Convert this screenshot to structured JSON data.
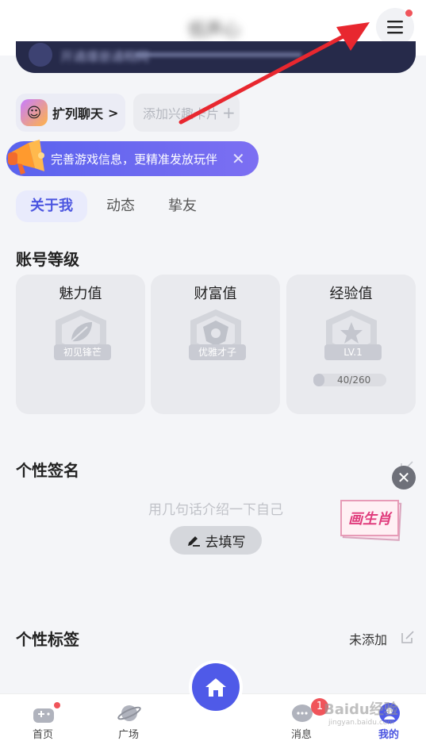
{
  "header": {
    "nickname": "低声心",
    "banner_text": "开通爆册通畅网"
  },
  "chips": {
    "chat_label": "扩列聊天",
    "chat_chevron": ">",
    "add_label": "添加兴趣卡片",
    "add_plus": "+"
  },
  "promo": {
    "text": "完善游戏信息，更精准发放玩伴",
    "close": "✕"
  },
  "tabs": [
    {
      "label": "关于我",
      "active": true
    },
    {
      "label": "动态",
      "active": false
    },
    {
      "label": "挚友",
      "active": false
    }
  ],
  "level_section": {
    "title": "账号等级",
    "cards": [
      {
        "title": "魅力值",
        "tag": "初见锋芒",
        "icon": "leaf-badge-icon"
      },
      {
        "title": "财富值",
        "tag": "优雅才子",
        "icon": "shield-badge-icon"
      },
      {
        "title": "经验值",
        "tag": "LV.1",
        "icon": "star-badge-icon",
        "progress_text": "40/260",
        "progress": 0.154
      }
    ]
  },
  "signature": {
    "title": "个性签名",
    "placeholder": "用几句话介绍一下自己",
    "fill_button": "去填写"
  },
  "float_ad": {
    "text": "画生肖",
    "close": "✕"
  },
  "tags_section": {
    "title": "个性标签",
    "value": "未添加"
  },
  "bottom_nav": {
    "home": "首页",
    "square": "广场",
    "messages": "消息",
    "messages_badge": "1",
    "mine": "我的"
  },
  "watermark": {
    "main": "Baidu经验",
    "sub": "jingyan.baidu.com"
  },
  "colors": {
    "accent": "#4b55e0",
    "promo_gradient_start": "#5a63ee",
    "badge_red": "#f0545a",
    "arrow_red": "#e8272f"
  }
}
